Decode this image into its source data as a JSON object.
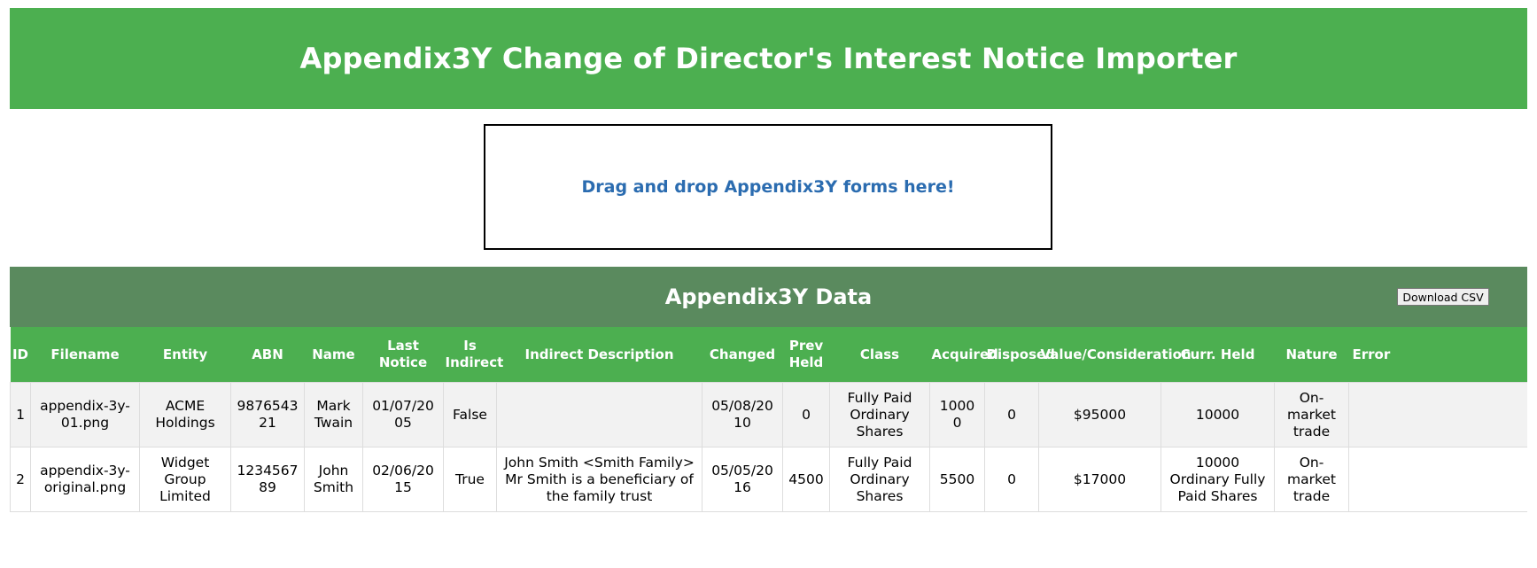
{
  "header": {
    "title": "Appendix3Y Change of Director's Interest Notice Importer"
  },
  "dropzone": {
    "label": "Drag and drop Appendix3Y forms here!"
  },
  "panel": {
    "title": "Appendix3Y Data",
    "download_label": "Download CSV"
  },
  "table": {
    "columns": [
      "ID",
      "Filename",
      "Entity",
      "ABN",
      "Name",
      "Last Notice",
      "Is Indirect",
      "Indirect Description",
      "Changed",
      "Prev Held",
      "Class",
      "Acquired",
      "Disposed",
      "Value/Consideration",
      "Curr. Held",
      "Nature",
      "Error"
    ],
    "rows": [
      [
        "1",
        "appendix-3y-01.png",
        "ACME Holdings",
        "987654321",
        "Mark Twain",
        "01/07/2005",
        "False",
        "",
        "05/08/2010",
        "0",
        "Fully Paid Ordinary Shares",
        "10000",
        "0",
        "$95000",
        "10000",
        "On-market trade",
        ""
      ],
      [
        "2",
        "appendix-3y-original.png",
        "Widget Group Limited",
        "123456789",
        "John Smith",
        "02/06/2015",
        "True",
        "John Smith <Smith Family> Mr Smith is a beneficiary of the family trust",
        "05/05/2016",
        "4500",
        "Fully Paid Ordinary Shares",
        "5500",
        "0",
        "$17000",
        "10000 Ordinary Fully Paid Shares",
        "On-market trade",
        ""
      ]
    ]
  },
  "colors": {
    "header_green": "#4caf50",
    "panel_green": "#5a8a5e",
    "dropzone_text": "#2b6cb0",
    "row_alt": "#f2f2f2"
  }
}
